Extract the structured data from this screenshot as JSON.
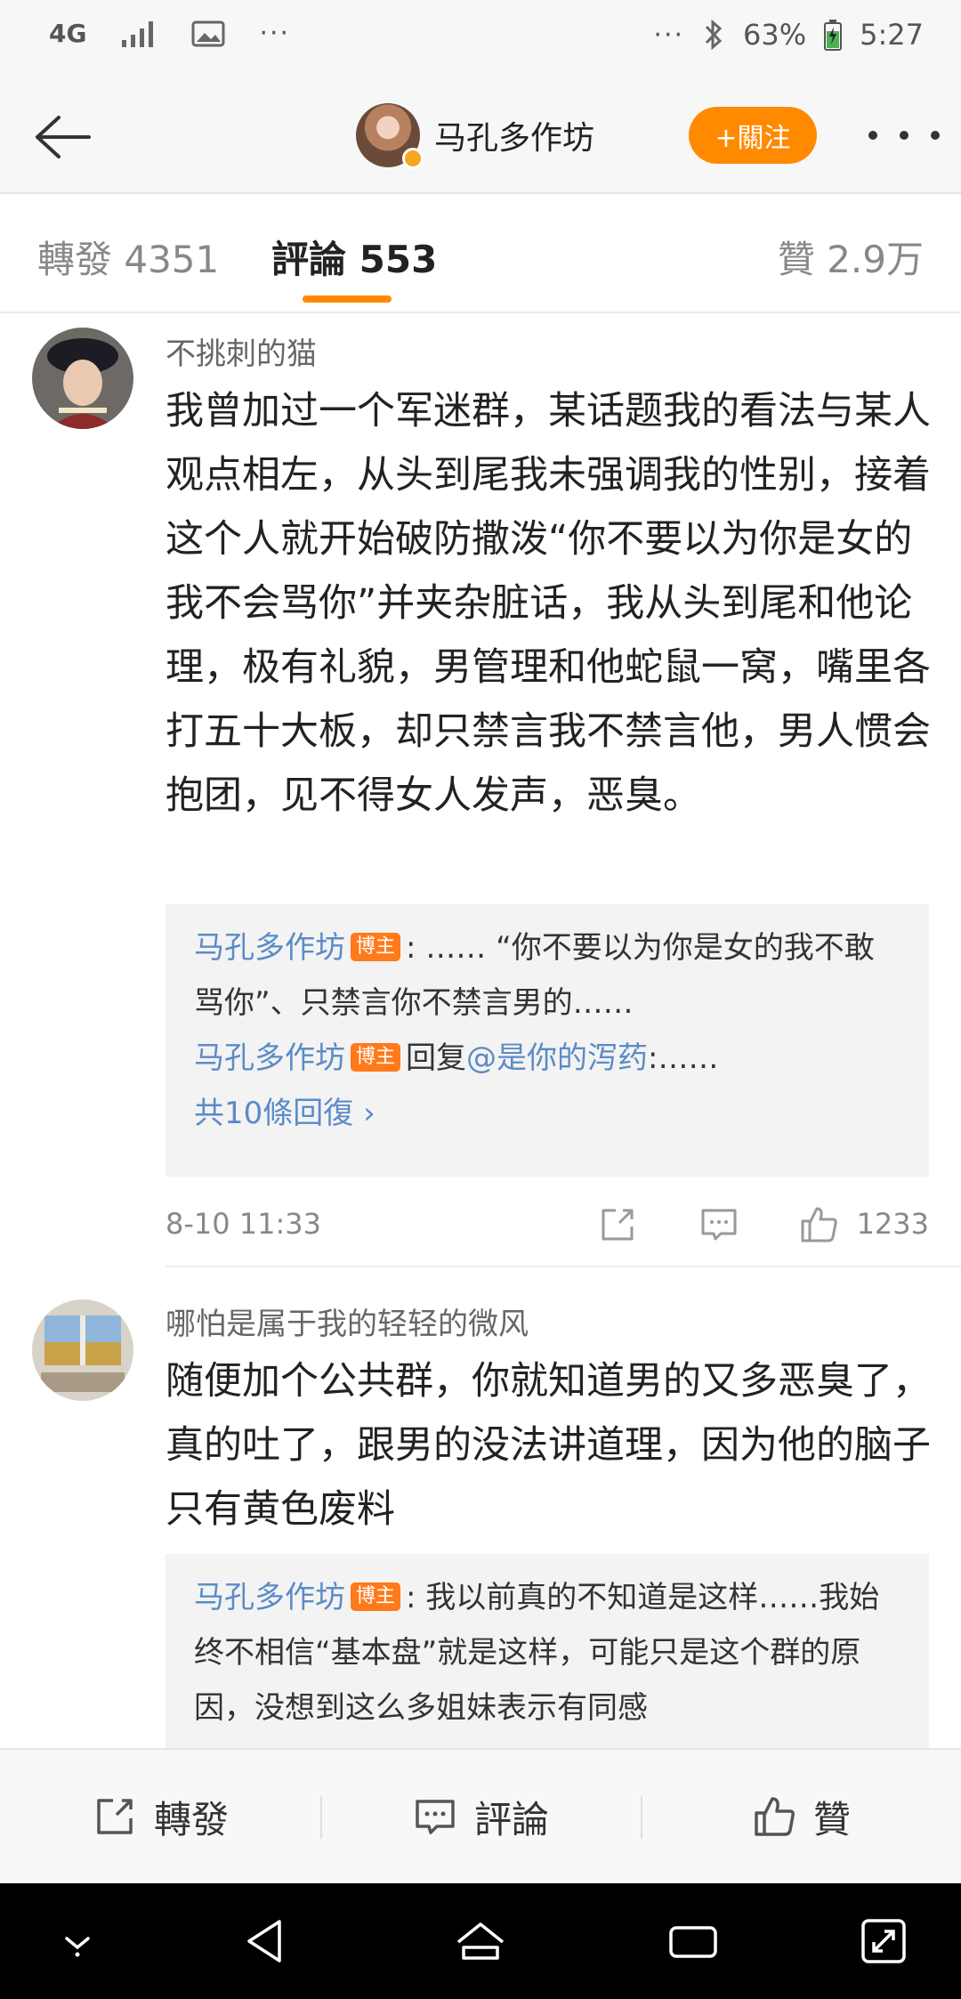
{
  "status_bar": {
    "network": "4G",
    "battery": "63%",
    "time": "5:27"
  },
  "header": {
    "account_name": "马孔多作坊",
    "follow_label": "+關注"
  },
  "tabs": [
    {
      "label": "轉發 4351"
    },
    {
      "label": "評論 553"
    },
    {
      "label": "贊 2.9万"
    }
  ],
  "comments": [
    {
      "user": "不挑刺的猫",
      "text": "我曾加过一个军迷群，某话题我的看法与某人观点相左，从头到尾我未强调我的性别，接着这个人就开始破防撒泼“你不要以为你是女的我不会骂你”并夹杂脏话，我从头到尾和他论理，极有礼貌，男管理和他蛇鼠一窝，嘴里各打五十大板，却只禁言我不禁言他，男人惯会抱团，见不得女人发声，恶臭。",
      "replies": [
        {
          "user": "马孔多作坊",
          "badge": "博主",
          "content": ": …… “你不要以为你是女的我不敢骂你”、只禁言你不禁言男的……"
        },
        {
          "user": "马孔多作坊",
          "badge": "博主",
          "prefix": "回复",
          "mention": "@是你的泻药",
          "content": ":……"
        }
      ],
      "more_replies": "共10條回復 ›",
      "time": "8-10 11:33",
      "likes": "1233"
    },
    {
      "user": "哪怕是属于我的轻轻的微风",
      "text": "随便加个公共群，你就知道男的又多恶臭了，真的吐了，跟男的没法讲道理，因为他的脑子只有黄色废料",
      "replies": [
        {
          "user": "马孔多作坊",
          "badge": "博主",
          "content": ": 我以前真的不知道是这样……我始终不相信“基本盘”就是这样，可能只是这个群的原因，没想到这么多姐妹表示有同感"
        }
      ]
    }
  ],
  "action_bar": {
    "repost": "轉發",
    "comment": "評論",
    "like": "贊"
  },
  "colors": {
    "accent": "#ff8a00",
    "link": "#5b8bc7",
    "badge": "#ff7a1a"
  }
}
